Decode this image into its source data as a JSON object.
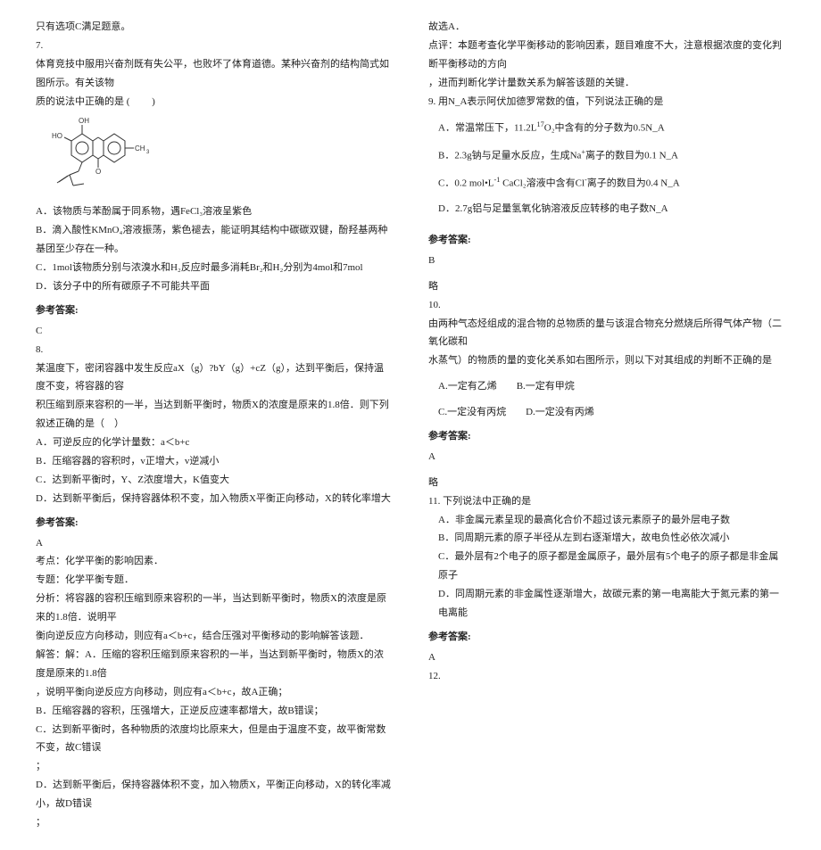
{
  "left": {
    "prelude": "只有选项C满足题意。",
    "q7": {
      "num": "7.",
      "stem1": "体育竞技中服用兴奋剂既有失公平，也败坏了体育道德。某种兴奋剂的结构简式如图所示。有关该物",
      "stem2": "质的说法中正确的是 (　　 )",
      "mol": {
        "labels": {
          "oh1": "OH",
          "oh2": "HO",
          "ch3": "CH",
          "ch3sub": "3",
          "o": "O"
        }
      },
      "a": "A．该物质与苯酚属于同系物，遇FeCl₃溶液呈紫色",
      "b": "B．滴入酸性KMnO₄溶液振荡，紫色褪去，能证明其结构中碳碳双键，酚羟基两种基团至少存在一种。",
      "c": "C．1mol该物质分别与浓溴水和H₂反应时最多消耗Br₂和H₂分别为4mol和7mol",
      "d": "D．该分子中的所有碳原子不可能共平面"
    },
    "ans_label": "参考答案:",
    "q7_ans": "C",
    "q8": {
      "num": "8.",
      "stem1": "某温度下，密闭容器中发生反应aX（g）?bY（g）+cZ（g），达到平衡后，保持温度不变，将容器的容",
      "stem2": "积压缩到原来容积的一半，当达到新平衡时，物质X的浓度是原来的1.8倍．则下列叙述正确的是（　）",
      "a": "A．可逆反应的化学计量数：a＜b+c",
      "b": "B．压缩容器的容积时，v正增大，v逆减小",
      "c": "C．达到新平衡时，Y、Z浓度增大，K值变大",
      "d": "D．达到新平衡后，保持容器体积不变，加入物质X平衡正向移动，X的转化率增大"
    },
    "q8_ans": "A",
    "q8_expl": {
      "l1": "考点：化学平衡的影响因素．",
      "l2": "专题：化学平衡专题．",
      "l3": "分析：将容器的容积压缩到原来容积的一半，当达到新平衡时，物质X的浓度是原来的1.8倍．说明平",
      "l4": "衡向逆反应方向移动，则应有a＜b+c，结合压强对平衡移动的影响解答该题．",
      "l5": "解答：解：A．压缩的容积压缩到原来容积的一半，当达到新平衡时，物质X的浓度是原来的1.8倍",
      "l6": "，说明平衡向逆反应方向移动，则应有a＜b+c，故A正确；",
      "l7": "B．压缩容器的容积，压强增大，正逆反应速率都增大，故B错误；",
      "l8": "C．达到新平衡时，各种物质的浓度均比原来大，但是由于温度不变，故平衡常数不变，故C错误",
      "semicolon": "；",
      "l9": "D．达到新平衡后，保持容器体积不变，加入物质X，平衡正向移动，X的转化率减小，故D错误",
      "semicolon2": "；"
    }
  },
  "right": {
    "q8_tail": {
      "l1": "故选A．",
      "l2": "点评：本题考查化学平衡移动的影响因素，题目难度不大，注意根据浓度的变化判断平衡移动的方向",
      "l3": "，进而判断化学计量数关系为解答该题的关键．"
    },
    "q9": {
      "num": "9. ",
      "stem": "用N_A表示阿伏加德罗常数的值，下列说法正确的是",
      "a1": "A．常温常压下，11.2L",
      "a_sup": "17",
      "a2": "O₂中含有的分子数为0.5N_A",
      "b1": "B．2.3g钠与足量水反应，生成Na",
      "b_sup": "+",
      "b2": "离子的数目为0.1 N_A",
      "c1": "C．0.2 mol•L",
      "c_sup1": "-1",
      "c2": " CaCl₂溶液中含有Cl",
      "c_sup2": "-",
      "c3": "离子的数目为0.4 N_A",
      "d": "D．2.7g铝与足量氢氧化钠溶液反应转移的电子数N_A"
    },
    "ans_label": "参考答案:",
    "q9_ans": "B",
    "q9_blank": "略",
    "q10": {
      "num": "10.",
      "stem1": "由两种气态烃组成的混合物的总物质的量与该混合物充分燃烧后所得气体产物（二氧化碳和",
      "stem2": "水蒸气）的物质的量的变化关系如右图所示，则以下对其组成的判断不正确的是",
      "a": "A.一定有乙烯　　B.一定有甲烷",
      "b": "C.一定没有丙烷　　D.一定没有丙烯"
    },
    "q10_ans": "A",
    "q10_blank": "略",
    "q11": {
      "num": "11. ",
      "stem": "下列说法中正确的是",
      "a": "A．非金属元素呈现的最高化合价不超过该元素原子的最外层电子数",
      "b": "B．同周期元素的原子半径从左到右逐渐增大，故电负性必依次减小",
      "c": "C．最外层有2个电子的原子都是金属原子，最外层有5个电子的原子都是非金属原子",
      "d": "D．同周期元素的非金属性逐渐增大，故碳元素的第一电离能大于氮元素的第一电离能"
    },
    "q11_ans": "A",
    "q12": {
      "num": "12."
    }
  }
}
